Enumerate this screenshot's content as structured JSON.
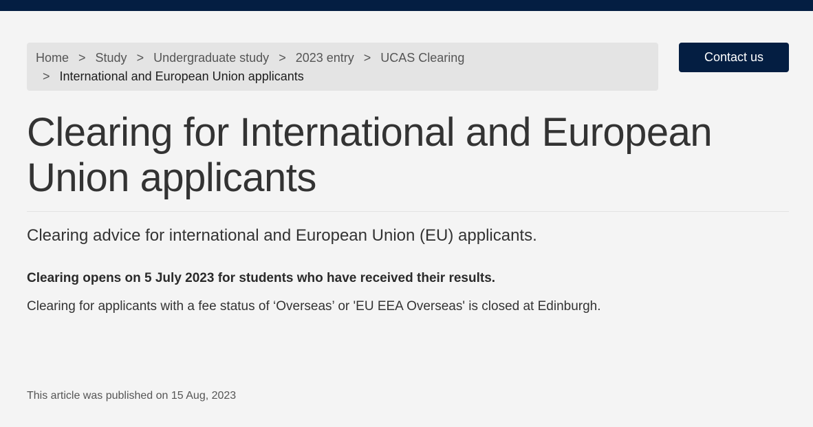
{
  "breadcrumb": {
    "items": [
      {
        "label": "Home"
      },
      {
        "label": "Study"
      },
      {
        "label": "Undergraduate study"
      },
      {
        "label": "2023 entry"
      },
      {
        "label": "UCAS Clearing"
      }
    ],
    "current": "International and European Union applicants",
    "separator": ">"
  },
  "header": {
    "contact_label": "Contact us"
  },
  "main": {
    "title": "Clearing for International and European Union applicants",
    "lead": "Clearing advice for international and European Union (EU) applicants.",
    "bold_note": "Clearing opens on 5 July 2023 for students who have received their results.",
    "body": "Clearing for applicants with a fee status of ‘Overseas’ or 'EU EEA Overseas' is closed at Edinburgh."
  },
  "footer": {
    "published": "This article was published on 15 Aug, 2023"
  },
  "colors": {
    "brand_navy": "#041e42",
    "page_background": "#f4f4f4",
    "breadcrumb_background": "#e4e4e4"
  }
}
